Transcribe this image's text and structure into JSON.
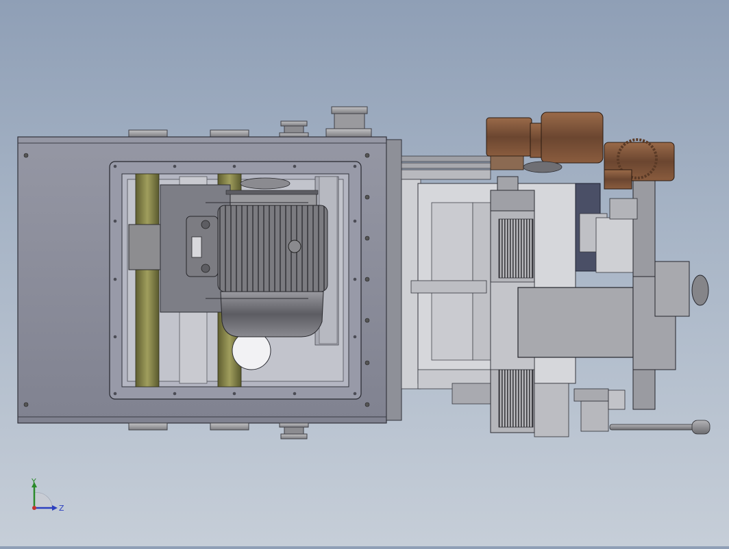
{
  "viewport": {
    "background_top": "#8f9fb6",
    "background_bottom": "#c6ced8",
    "model_colors": {
      "frame": "#8a8c99",
      "frame_dark": "#5e606a",
      "rail": "#7e7d45",
      "motor": "#6d6d72",
      "gearbox": "#7a5238",
      "ring": "#a7a7a7",
      "bracket": "#b9b9bd",
      "panel_blue": "#4a4f66"
    }
  },
  "triad": {
    "y_label": "Y",
    "z_label": "Z",
    "y_color": "#2a8a2a",
    "z_color": "#2c3fbf",
    "x_color": "#c2332e"
  }
}
